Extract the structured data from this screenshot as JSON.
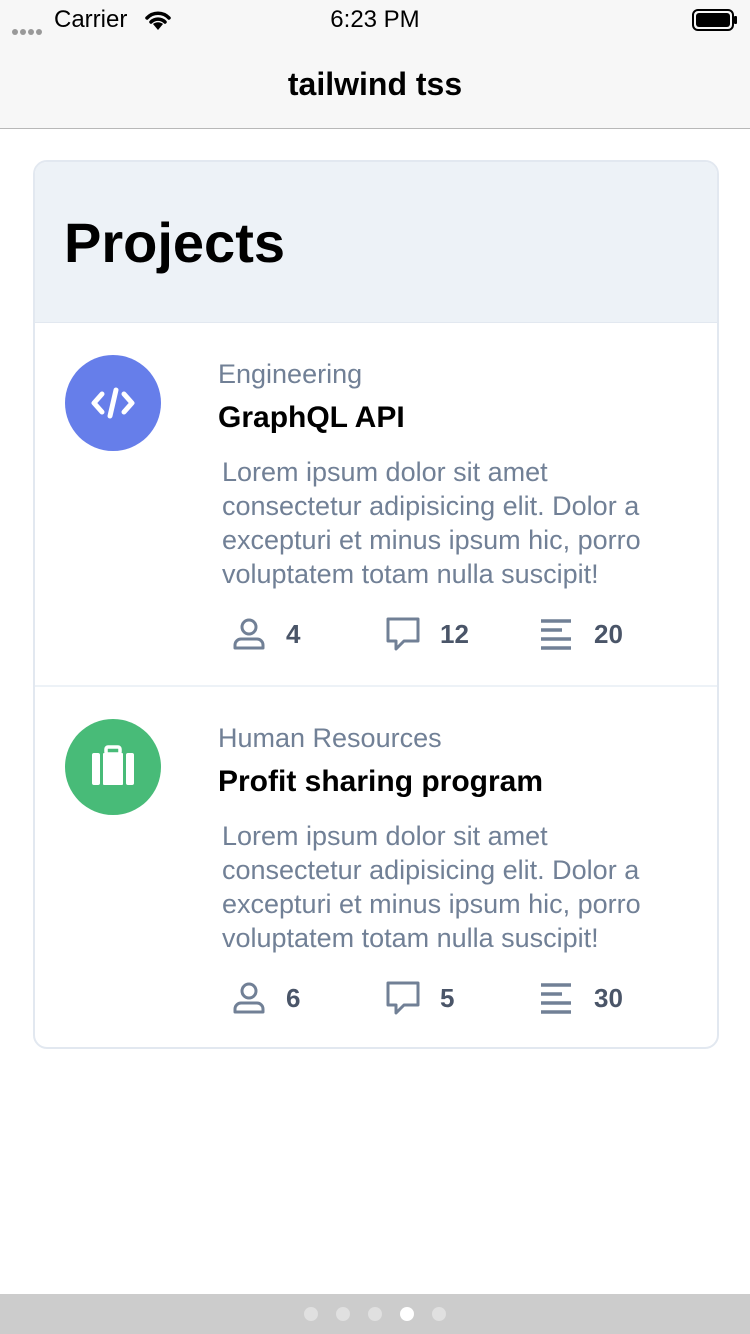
{
  "status_bar": {
    "carrier": "Carrier",
    "time": "6:23 PM",
    "icons": [
      "signal-icon",
      "wifi-icon",
      "battery-icon"
    ]
  },
  "nav": {
    "title": "tailwind tss"
  },
  "card": {
    "title": "Projects",
    "projects": [
      {
        "category": "Engineering",
        "name": "GraphQL API",
        "description": "Lorem ipsum dolor sit amet consectetur adipisicing elit. Dolor a excepturi et minus ipsum hic, porro voluptatem totam nulla suscipit!",
        "icon": "code-icon",
        "icon_color": "#667eea",
        "members": "4",
        "comments": "12",
        "tasks": "20"
      },
      {
        "category": "Human Resources",
        "name": "Profit sharing program",
        "description": "Lorem ipsum dolor sit amet consectetur adipisicing elit. Dolor a excepturi et minus ipsum hic, porro voluptatem totam nulla suscipit!",
        "icon": "briefcase-icon",
        "icon_color": "#48bb78",
        "members": "6",
        "comments": "5",
        "tasks": "30"
      }
    ]
  },
  "page_indicator": {
    "count": 5,
    "active_index": 3
  },
  "colors": {
    "muted_text": "#718096",
    "stat_text": "#4a5568",
    "header_bg": "#edf2f7",
    "border": "#e2e8f0"
  }
}
